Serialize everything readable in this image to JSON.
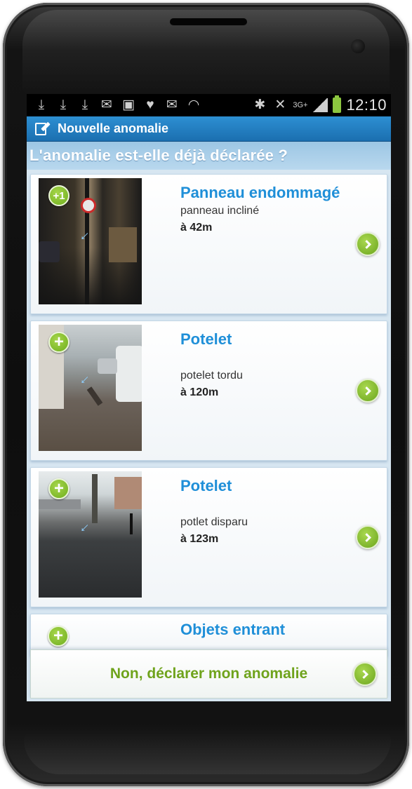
{
  "status_bar": {
    "time": "12:10",
    "network": "3G+",
    "icons": [
      "download-icon",
      "download-icon",
      "download-icon",
      "mail-icon",
      "image-icon",
      "twitter-icon",
      "gmail-icon",
      "wifi-icon",
      "bluetooth-icon",
      "mute-icon",
      "network-3g-icon",
      "signal-icon",
      "battery-icon"
    ]
  },
  "app_bar": {
    "title": "Nouvelle anomalie",
    "icon": "edit-document-icon"
  },
  "question": "L'anomalie est-elle déjà déclarée ?",
  "anomalies": [
    {
      "badge": "+1",
      "title": "Panneau endommagé",
      "description": "panneau incliné",
      "distance": "à 42m"
    },
    {
      "badge": "+",
      "title": "Potelet",
      "description": "potelet tordu",
      "distance": "à 120m"
    },
    {
      "badge": "+",
      "title": "Potelet",
      "description": "potlet disparu",
      "distance": "à 123m"
    },
    {
      "badge": "+",
      "title": "Objets entrant"
    }
  ],
  "declare_button": {
    "label": "Non, déclarer mon anomalie"
  },
  "colors": {
    "accent_blue": "#1f8fd8",
    "accent_green": "#6fa31c",
    "app_bar": "#2d8fd2"
  }
}
